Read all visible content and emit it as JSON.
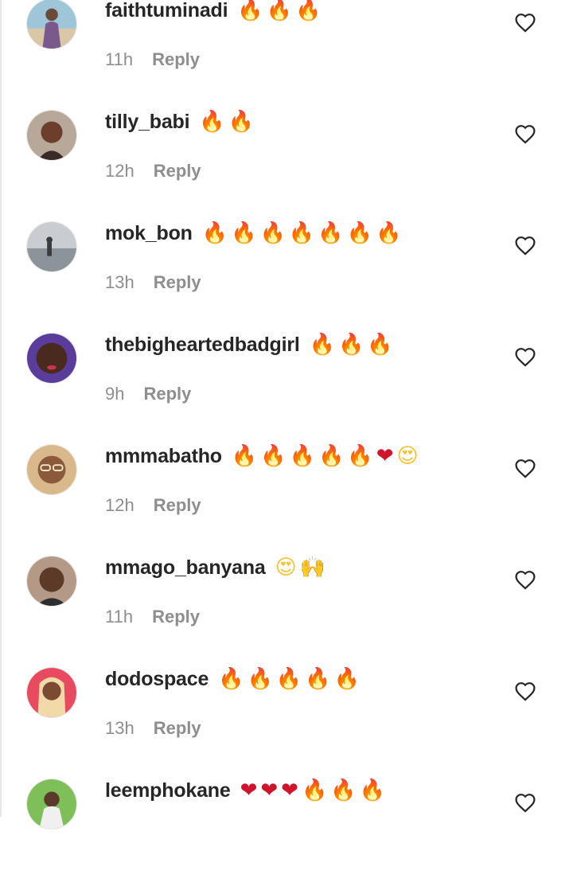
{
  "comments": [
    {
      "username": "faithtuminadi",
      "emojis": "🔥🔥🔥",
      "time": "11h",
      "reply": "Reply",
      "avatar": "avatar-woman-beach"
    },
    {
      "username": "tilly_babi",
      "emojis": "🔥🔥",
      "time": "12h",
      "reply": "Reply",
      "avatar": "avatar-woman-selfie"
    },
    {
      "username": "mok_bon",
      "emojis": "🔥🔥🔥🔥🔥🔥🔥",
      "time": "13h",
      "reply": "Reply",
      "avatar": "avatar-person-shore"
    },
    {
      "username": "thebigheartedbadgirl",
      "emojis": "🔥🔥🔥",
      "time": "9h",
      "reply": "Reply",
      "avatar": "avatar-woman-purple"
    },
    {
      "username": "mmmabatho",
      "emojis": "🔥🔥🔥🔥🔥❤️😍",
      "time": "12h",
      "reply": "Reply",
      "avatar": "avatar-woman-glasses"
    },
    {
      "username": "mmago_banyana",
      "emojis": "😍🙌",
      "time": "11h",
      "reply": "Reply",
      "avatar": "avatar-woman-indoor"
    },
    {
      "username": "dodospace",
      "emojis": "🔥🔥🔥🔥🔥",
      "time": "13h",
      "reply": "Reply",
      "avatar": "avatar-woman-blonde"
    },
    {
      "username": "leemphokane",
      "emojis": "❤️❤️❤️🔥🔥🔥",
      "time": "",
      "reply": "",
      "avatar": "avatar-person-outdoor"
    }
  ],
  "colors": {
    "text": "#262626",
    "secondary": "#8e8e8e",
    "background": "#ffffff"
  },
  "icons": {
    "like": "heart-outline-icon"
  }
}
